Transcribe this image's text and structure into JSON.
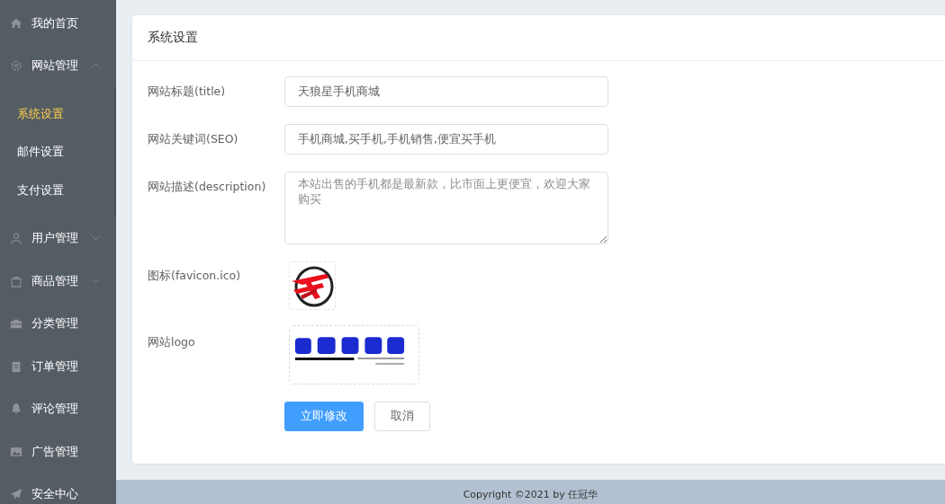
{
  "sidebar": {
    "items": [
      {
        "label": "我的首页"
      },
      {
        "label": "网站管理",
        "expanded": true,
        "children": [
          {
            "label": "系统设置",
            "selected": true
          },
          {
            "label": "邮件设置",
            "selected": false
          },
          {
            "label": "支付设置",
            "selected": false
          }
        ]
      },
      {
        "label": "用户管理",
        "expanded": false
      },
      {
        "label": "商品管理",
        "expanded": false
      },
      {
        "label": "分类管理"
      },
      {
        "label": "订单管理"
      },
      {
        "label": "评论管理"
      },
      {
        "label": "广告管理"
      },
      {
        "label": "安全中心"
      }
    ]
  },
  "card": {
    "title": "系统设置",
    "fields": [
      {
        "kind": "input",
        "label": "网站标题(title)",
        "value": "天狼星手机商城"
      },
      {
        "kind": "input",
        "label": "网站关键词(SEO)",
        "value": "手机商城,买手机,手机销售,便宜买手机"
      },
      {
        "kind": "textarea",
        "label": "网站描述(description)",
        "placeholder": "本站出售的手机都是最新款，比市面上更便宜，欢迎大家购买"
      },
      {
        "kind": "favicon",
        "label": "图标(favicon.ico)"
      },
      {
        "kind": "logo",
        "label": "网站logo"
      }
    ],
    "buttons": [
      {
        "kind": "primary",
        "label": "立即修改"
      },
      {
        "kind": "plain",
        "label": "取消"
      }
    ]
  },
  "footer": "Copyright ©2021 by 任冠华"
}
